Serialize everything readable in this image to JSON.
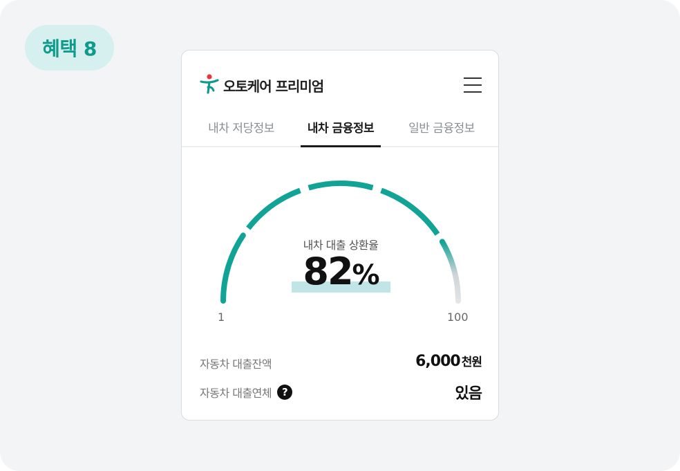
{
  "badge": {
    "label": "혜택 8"
  },
  "app": {
    "title": "오토케어 프리미엄"
  },
  "tabs": [
    {
      "label": "내차 저당정보"
    },
    {
      "label": "내차 금융정보"
    },
    {
      "label": "일반 금융정보"
    }
  ],
  "gauge": {
    "label": "내차 대출 상환율",
    "value": "82",
    "unit": "%",
    "min": "1",
    "max": "100",
    "fraction": 0.82,
    "accent": "#12a397",
    "track": "#e2e4e6"
  },
  "loan_balance": {
    "label": "자동차 대출잔액",
    "value": "6,000",
    "unit": "천원"
  },
  "loan_overdue": {
    "label": "자동차 대출연체",
    "help_icon": "question-icon",
    "help_glyph": "?",
    "value": "있음"
  }
}
